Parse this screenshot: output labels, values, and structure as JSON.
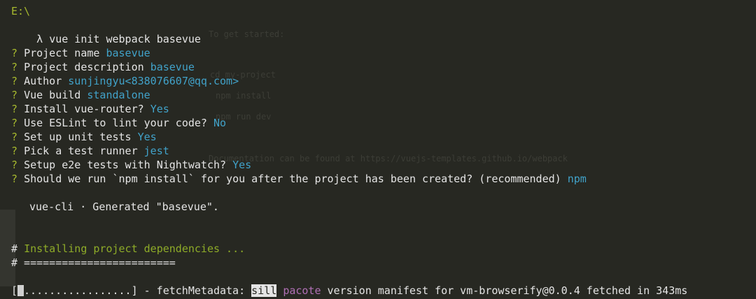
{
  "prompt_path": "E:\\",
  "prompt_symbol": "λ",
  "command": "vue init webpack basevue",
  "questions": [
    {
      "label": "Project name",
      "answer": "basevue"
    },
    {
      "label": "Project description",
      "answer": "basevue"
    },
    {
      "label": "Author",
      "answer": "sunjingyu<838076607@qq.com>"
    },
    {
      "label": "Vue build",
      "answer": "standalone"
    },
    {
      "label": "Install vue-router?",
      "answer": "Yes"
    },
    {
      "label": "Use ESLint to lint your code?",
      "answer": "No"
    },
    {
      "label": "Set up unit tests",
      "answer": "Yes"
    },
    {
      "label": "Pick a test runner",
      "answer": "jest"
    },
    {
      "label": "Setup e2e tests with Nightwatch?",
      "answer": "Yes"
    },
    {
      "label": "Should we run `npm install` for you after the project has been created? (recommended)",
      "answer": "npm"
    }
  ],
  "question_mark": "?",
  "generated": "vue-cli · Generated \"basevue\".",
  "installing_hash": "#",
  "installing": "Installing project dependencies ...",
  "separator": "# ========================",
  "progress_open": "[",
  "progress_dots": ".................",
  "progress_close": "] - fetchMetadata: ",
  "log_level": "sill",
  "log_source": "pacote",
  "log_message": " version manifest for vm-browserify@0.0.4 fetched in 343ms",
  "background_ghost": [
    "To get started:",
    "cd my-project",
    "npm install",
    "npm run dev",
    "Documentation can be found at https://vuejs-templates.github.io/webpack"
  ],
  "colors": {
    "background": "#272822",
    "question": "#a6b82e",
    "answer": "#41a2c9",
    "comment": "#8eab28",
    "pacote": "#b06fb5"
  }
}
